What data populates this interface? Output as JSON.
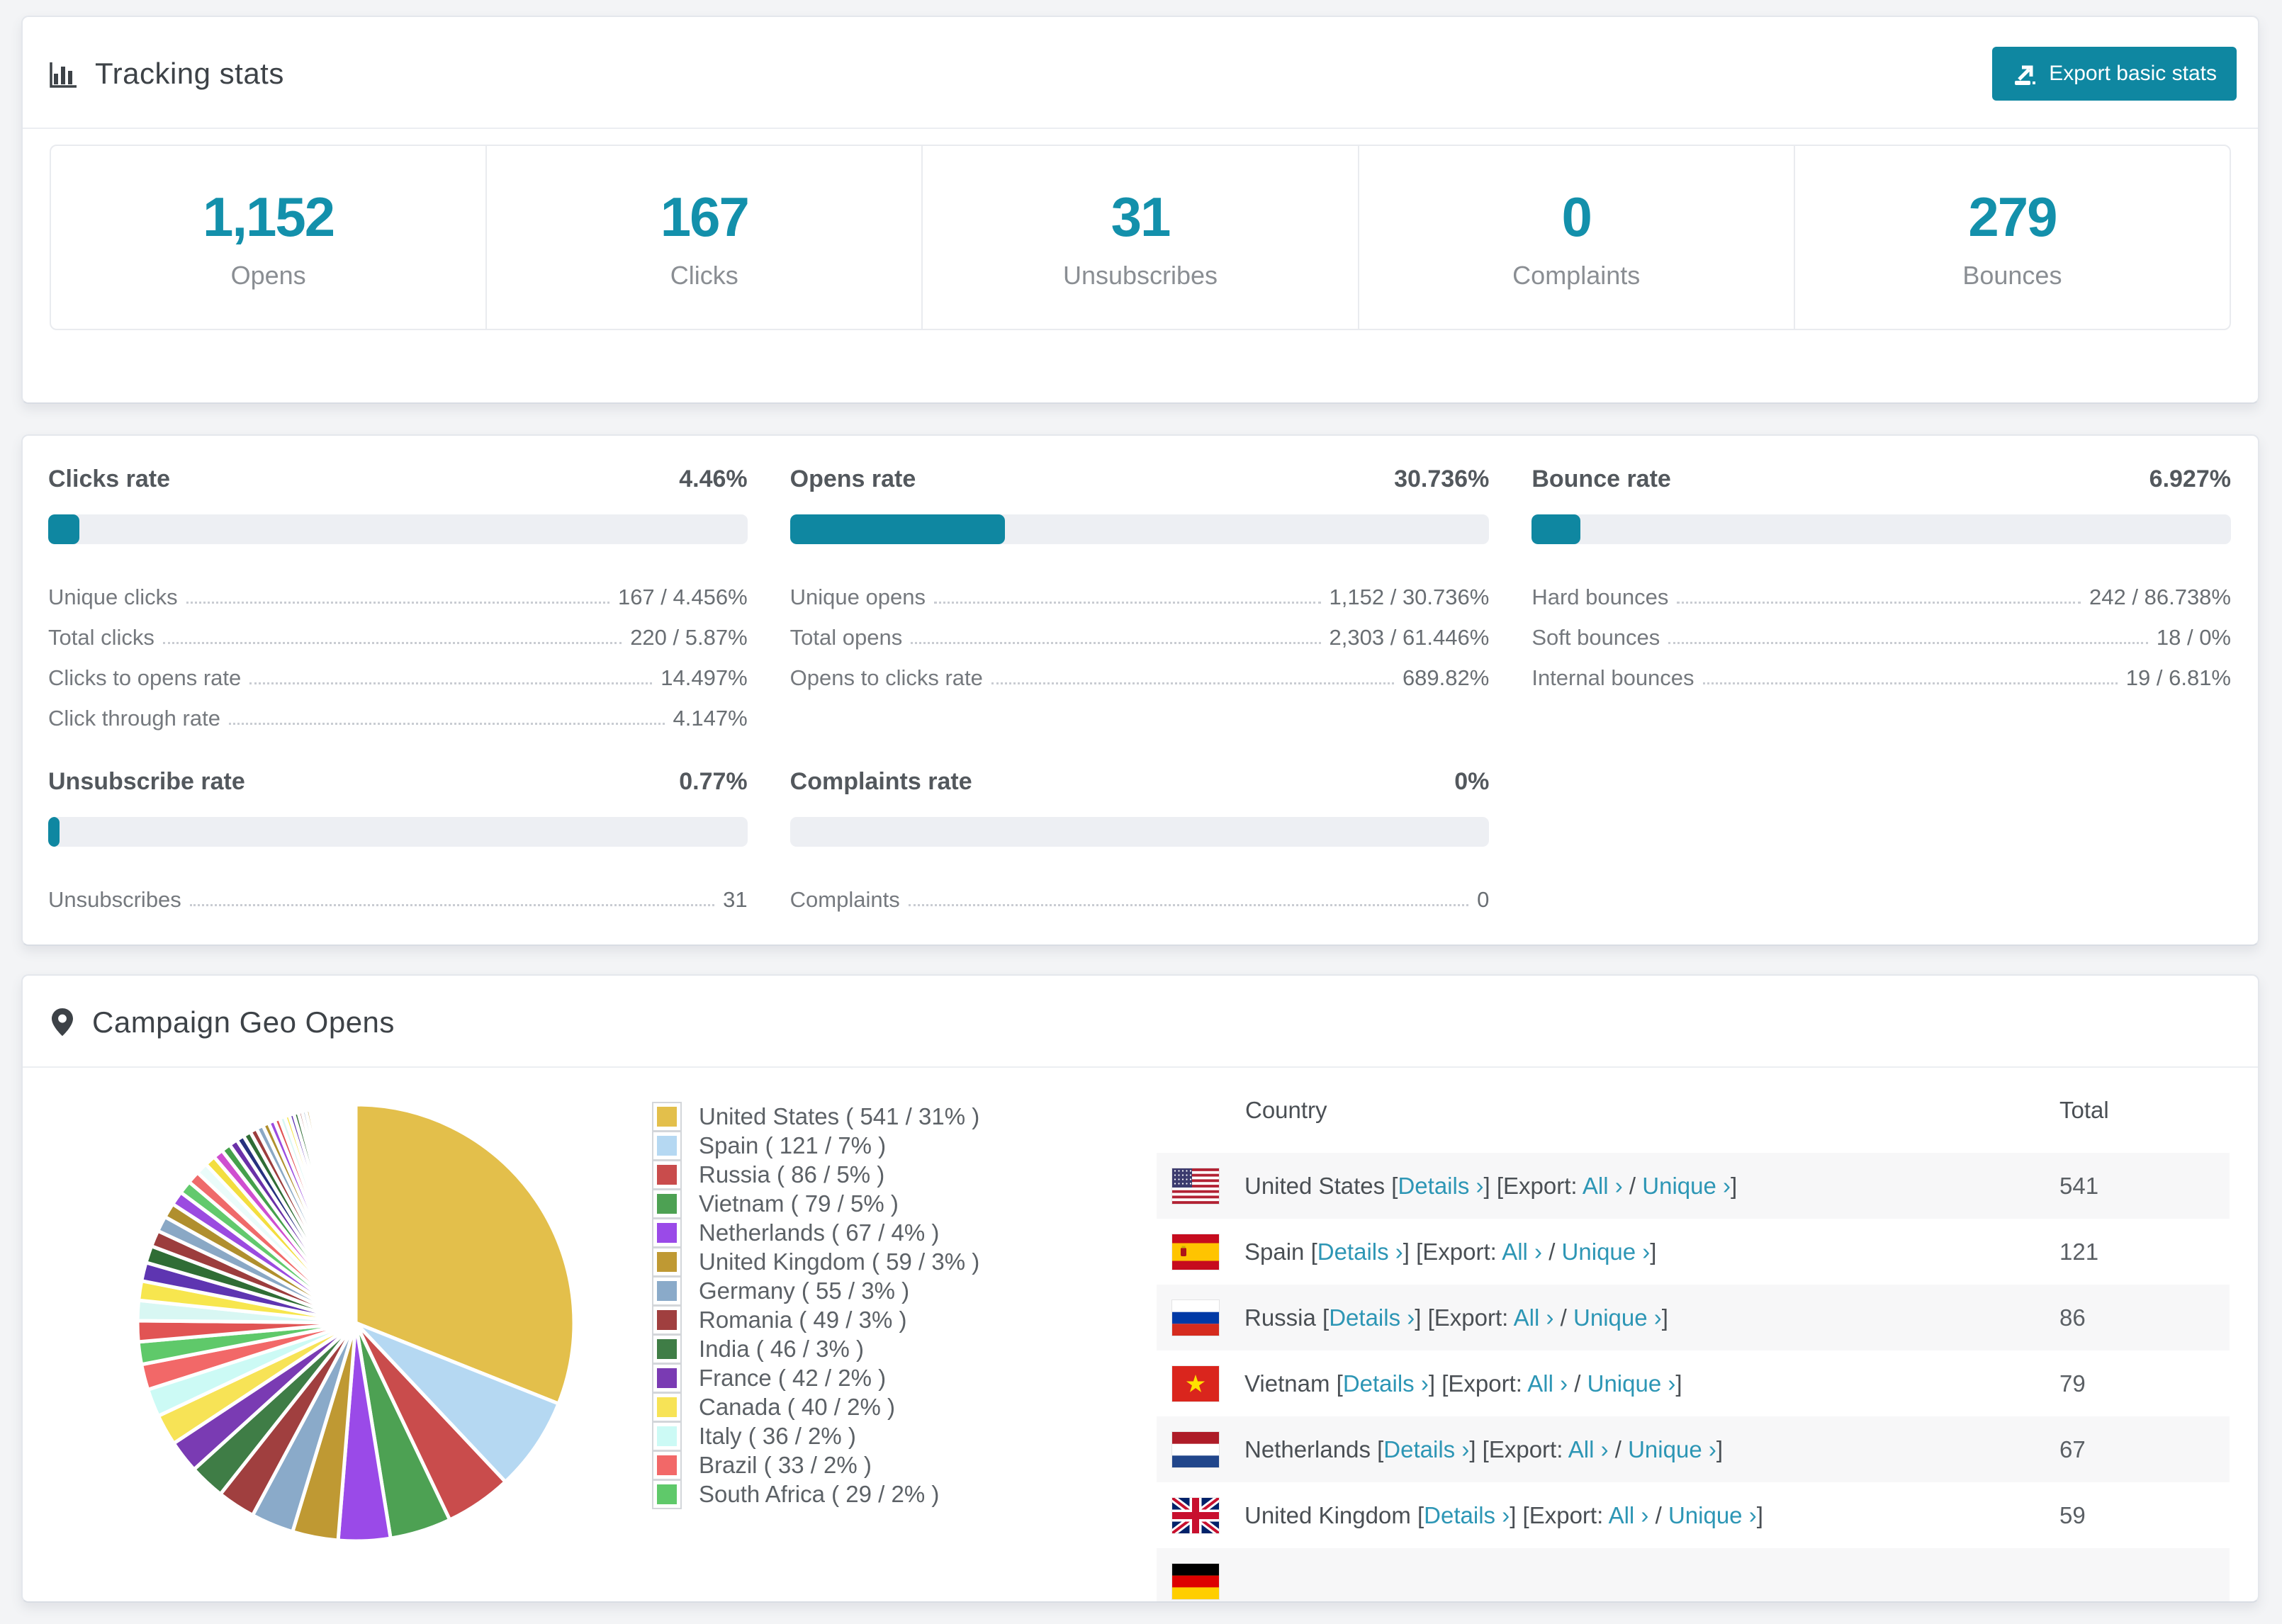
{
  "page": {
    "accent": "#0f87a1",
    "link_color": "#2d96b5"
  },
  "tracking": {
    "title": "Tracking stats",
    "export_button": "Export basic stats",
    "stats": [
      {
        "value": "1,152",
        "label": "Opens"
      },
      {
        "value": "167",
        "label": "Clicks"
      },
      {
        "value": "31",
        "label": "Unsubscribes"
      },
      {
        "value": "0",
        "label": "Complaints"
      },
      {
        "value": "279",
        "label": "Bounces"
      }
    ]
  },
  "rates": {
    "blocks": [
      {
        "title": "Clicks rate",
        "value": "4.46%",
        "pct": 4.46,
        "rows": [
          [
            "Unique clicks",
            "167 / 4.456%"
          ],
          [
            "Total clicks",
            "220 / 5.87%"
          ],
          [
            "Clicks to opens rate",
            "14.497%"
          ],
          [
            "Click through rate",
            "4.147%"
          ]
        ]
      },
      {
        "title": "Opens rate",
        "value": "30.736%",
        "pct": 30.736,
        "rows": [
          [
            "Unique opens",
            "1,152 / 30.736%"
          ],
          [
            "Total opens",
            "2,303 / 61.446%"
          ],
          [
            "Opens to clicks rate",
            "689.82%"
          ]
        ]
      },
      {
        "title": "Bounce rate",
        "value": "6.927%",
        "pct": 6.927,
        "rows": [
          [
            "Hard bounces",
            "242 / 86.738%"
          ],
          [
            "Soft bounces",
            "18 / 0%"
          ],
          [
            "Internal bounces",
            "19 / 6.81%"
          ]
        ]
      },
      {
        "title": "Unsubscribe rate",
        "value": "0.77%",
        "pct": 0.77,
        "rows": [
          [
            "Unsubscribes",
            "31"
          ]
        ]
      },
      {
        "title": "Complaints rate",
        "value": "0%",
        "pct": 0,
        "rows": [
          [
            "Complaints",
            "0"
          ]
        ]
      }
    ]
  },
  "geo": {
    "title": "Campaign Geo Opens",
    "table": {
      "columns": [
        "Country",
        "Total"
      ],
      "link_labels": {
        "details": "Details ›",
        "export": "[Export:",
        "all": "All ›",
        "slash": "/",
        "unique": "Unique ›",
        "open": "[",
        "close": "]"
      },
      "rows": [
        {
          "flag": "us",
          "country": "United States",
          "total": "541"
        },
        {
          "flag": "es",
          "country": "Spain",
          "total": "121"
        },
        {
          "flag": "ru",
          "country": "Russia",
          "total": "86"
        },
        {
          "flag": "vn",
          "country": "Vietnam",
          "total": "79"
        },
        {
          "flag": "nl",
          "country": "Netherlands",
          "total": "67"
        },
        {
          "flag": "gb",
          "country": "United Kingdom",
          "total": "59"
        },
        {
          "flag": "de",
          "country": "",
          "total": ""
        }
      ]
    }
  },
  "chart_data": {
    "type": "pie",
    "title": "Campaign Geo Opens",
    "legend_position": "right",
    "categories": [
      "United States",
      "Spain",
      "Russia",
      "Vietnam",
      "Netherlands",
      "United Kingdom",
      "Germany",
      "Romania",
      "India",
      "France",
      "Canada",
      "Italy",
      "Brazil",
      "South Africa"
    ],
    "values": [
      541,
      121,
      86,
      79,
      67,
      59,
      55,
      49,
      46,
      42,
      40,
      36,
      33,
      29
    ],
    "percents": [
      31,
      7,
      5,
      5,
      4,
      3,
      3,
      3,
      3,
      2,
      2,
      2,
      2,
      2
    ],
    "legend_labels": [
      "United States ( 541 / 31% )",
      "Spain ( 121 / 7% )",
      "Russia ( 86 / 5% )",
      "Vietnam ( 79 / 5% )",
      "Netherlands ( 67 / 4% )",
      "United Kingdom ( 59 / 3% )",
      "Germany ( 55 / 3% )",
      "Romania ( 49 / 3% )",
      "India ( 46 / 3% )",
      "France ( 42 / 2% )",
      "Canada ( 40 / 2% )",
      "Italy ( 36 / 2% )",
      "Brazil ( 33 / 2% )",
      "South Africa ( 29 / 2% )"
    ],
    "colors": [
      "#e3bf4b",
      "#b5d8f2",
      "#c94c4c",
      "#4da153",
      "#9a4ae8",
      "#bf9933",
      "#8aaac9",
      "#a03f3f",
      "#3f7d46",
      "#7a3bb3",
      "#f7e356",
      "#ccfaf5",
      "#f26868",
      "#5fc96a"
    ],
    "other_slices": {
      "values": [
        27,
        26,
        25,
        24,
        22,
        21,
        20,
        19,
        18,
        17,
        16,
        15,
        14,
        13,
        12,
        11,
        10,
        10,
        9,
        9,
        8,
        8,
        7,
        7,
        6,
        6,
        6,
        5,
        5,
        5,
        4,
        4,
        4,
        4,
        3,
        3,
        3,
        3,
        3,
        2,
        2,
        2,
        2,
        2,
        2,
        2,
        1,
        1,
        1,
        1,
        1,
        1,
        1,
        1,
        1,
        1,
        1,
        1,
        1,
        1
      ],
      "colors": [
        "#e15454",
        "#d8f7f3",
        "#f7e64e",
        "#5e35b1",
        "#2f6d35",
        "#9c3d3d",
        "#8aa8c5",
        "#b08f2e",
        "#9b4be0",
        "#62c96d",
        "#ef6a6a",
        "#eafcfa",
        "#f3de3f",
        "#cf4fd0",
        "#45a04b",
        "#6a30a8",
        "#27317e",
        "#2f6d35",
        "#9c3d3d",
        "#8aa8c5",
        "#b08f2e",
        "#9b4be0"
      ]
    }
  }
}
